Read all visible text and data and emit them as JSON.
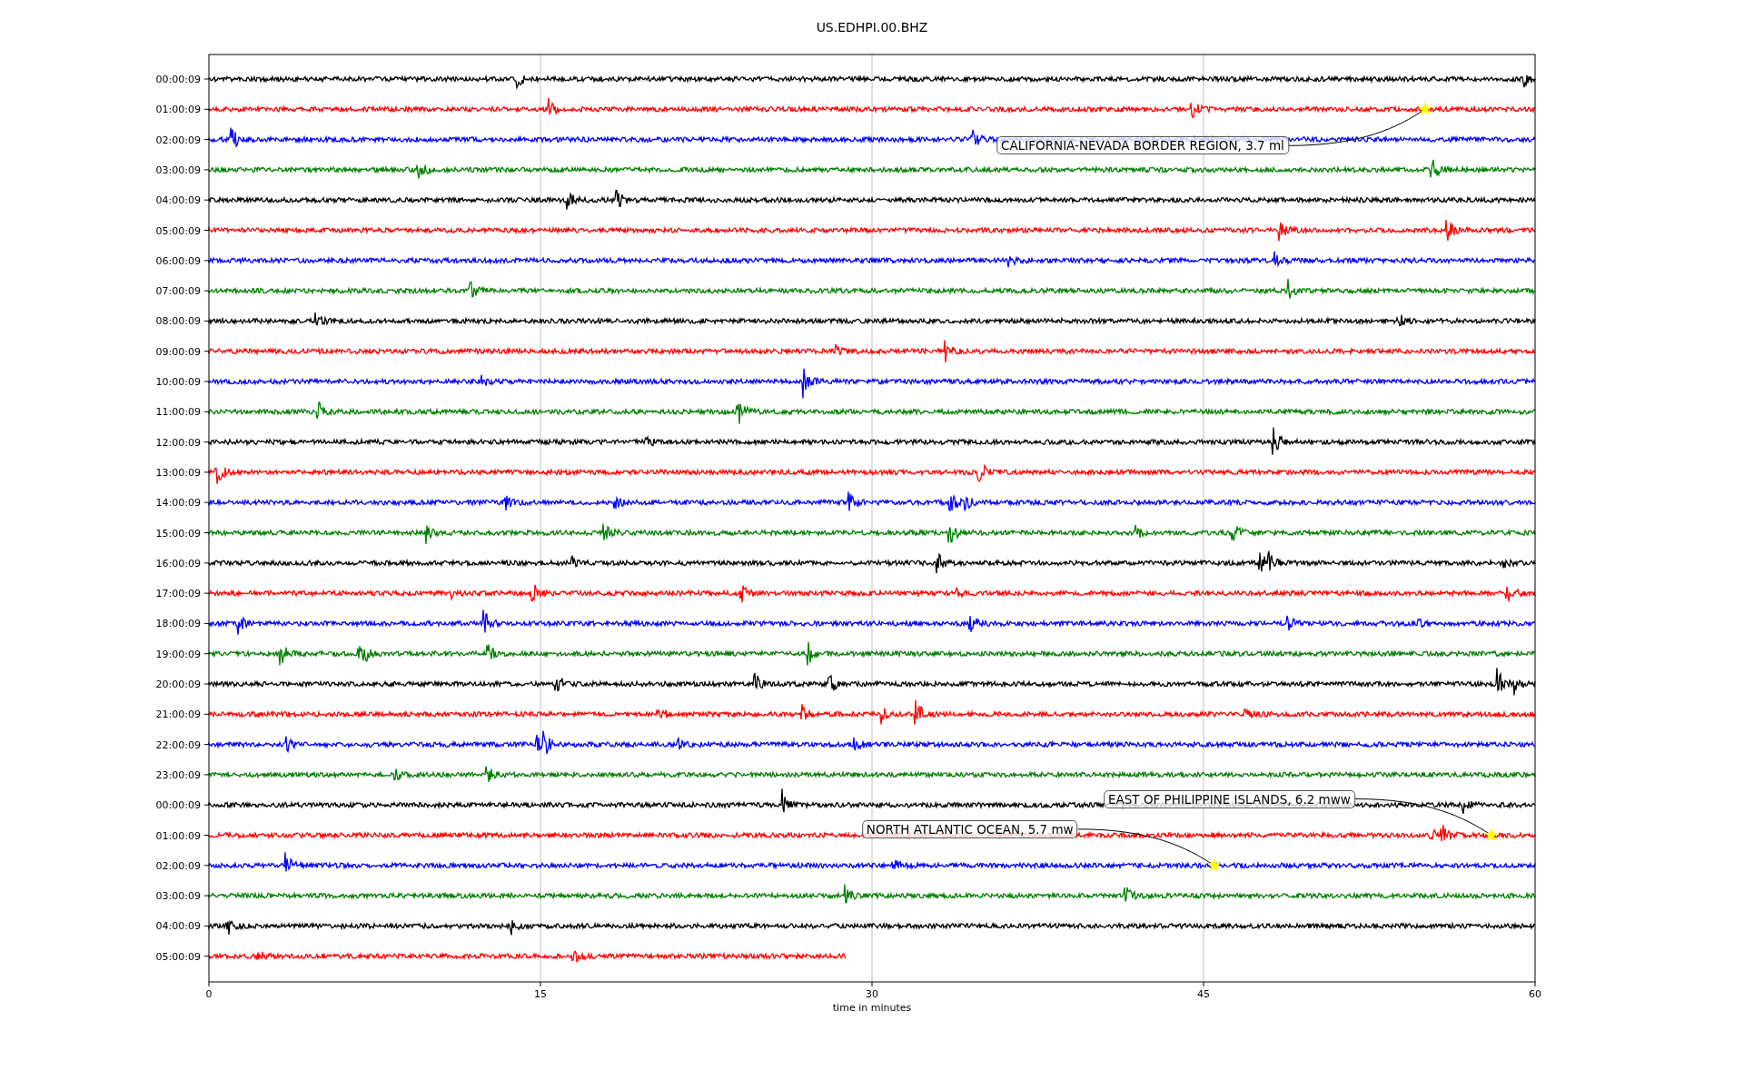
{
  "title": "US.EDHPI.00.BHZ",
  "xlabel": "time in minutes",
  "xticks": [
    "0",
    "15",
    "30",
    "45",
    "60"
  ],
  "traces": [
    {
      "label": "00:00:09",
      "color": "#000000",
      "level": 1
    },
    {
      "label": "01:00:09",
      "color": "#ff0000",
      "level": 1,
      "event": {
        "text": "CALIFORNIA-NEVADA BORDER REGION, 3.7 ml",
        "level": 0.917
      }
    },
    {
      "label": "02:00:09",
      "color": "#0000ff",
      "level": 1
    },
    {
      "label": "03:00:09",
      "color": "#008000",
      "level": 1
    },
    {
      "label": "04:00:09",
      "color": "#000000",
      "level": 1
    },
    {
      "label": "05:00:09",
      "color": "#ff0000",
      "level": 1
    },
    {
      "label": "06:00:09",
      "color": "#0000ff",
      "level": 1
    },
    {
      "label": "07:00:09",
      "color": "#008000",
      "level": 1
    },
    {
      "label": "08:00:09",
      "color": "#000000",
      "level": 1
    },
    {
      "label": "09:00:09",
      "color": "#ff0000",
      "level": 1
    },
    {
      "label": "10:00:09",
      "color": "#0000ff",
      "level": 1
    },
    {
      "label": "11:00:09",
      "color": "#008000",
      "level": 1
    },
    {
      "label": "12:00:09",
      "color": "#000000",
      "level": 1
    },
    {
      "label": "13:00:09",
      "color": "#ff0000",
      "level": 1
    },
    {
      "label": "14:00:09",
      "color": "#0000ff",
      "level": 1
    },
    {
      "label": "15:00:09",
      "color": "#008000",
      "level": 1
    },
    {
      "label": "16:00:09",
      "color": "#000000",
      "level": 1
    },
    {
      "label": "17:00:09",
      "color": "#ff0000",
      "level": 1
    },
    {
      "label": "18:00:09",
      "color": "#0000ff",
      "level": 1
    },
    {
      "label": "19:00:09",
      "color": "#008000",
      "level": 1
    },
    {
      "label": "20:00:09",
      "color": "#000000",
      "level": 1
    },
    {
      "label": "21:00:09",
      "color": "#ff0000",
      "level": 1
    },
    {
      "label": "22:00:09",
      "color": "#0000ff",
      "level": 1
    },
    {
      "label": "23:00:09",
      "color": "#008000",
      "level": 1
    },
    {
      "label": "00:00:09",
      "color": "#000000",
      "level": 1
    },
    {
      "label": "01:00:09",
      "color": "#ff0000",
      "level": 1,
      "event": {
        "text": "EAST OF PHILIPPINE ISLANDS, 6.2 mww",
        "level": 0.967
      }
    },
    {
      "label": "02:00:09",
      "color": "#0000ff",
      "level": 1,
      "event": {
        "text": "NORTH ATLANTIC OCEAN, 5.7 mw",
        "level": 0.758
      }
    },
    {
      "label": "03:00:09",
      "color": "#008000",
      "level": 1
    },
    {
      "label": "04:00:09",
      "color": "#000000",
      "level": 1
    },
    {
      "label": "05:00:09",
      "color": "#ff0000",
      "level": 0.48
    }
  ]
}
